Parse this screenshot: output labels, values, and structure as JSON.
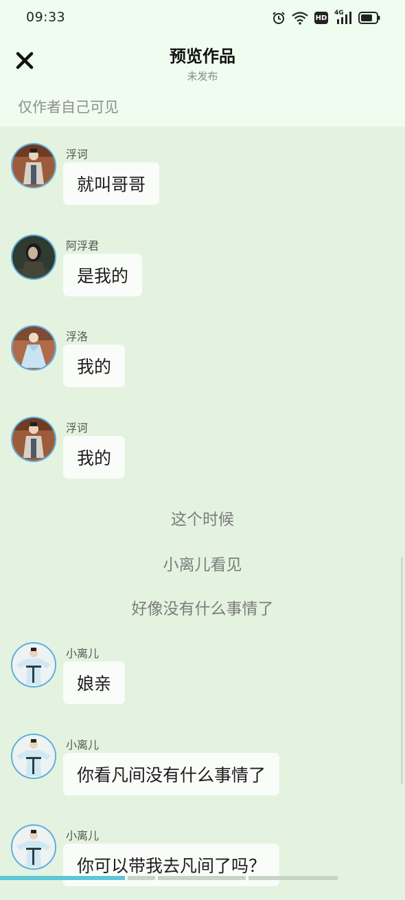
{
  "status_bar": {
    "time": "09:33",
    "icons": [
      "alarm-icon",
      "wifi-icon",
      "hd-icon",
      "signal-4g-icon",
      "battery-icon"
    ],
    "network_label": "4G",
    "hd_label": "HD"
  },
  "header": {
    "title": "预览作品",
    "subtitle": "未发布",
    "close_icon": "close-icon",
    "visibility_note": "仅作者自己可见"
  },
  "messages": [
    {
      "sender": "浮诃",
      "text": "就叫哥哥",
      "avatar": "avatar-fuhe"
    },
    {
      "sender": "阿浮君",
      "text": "是我的",
      "avatar": "avatar-afujun"
    },
    {
      "sender": "浮洛",
      "text": "我的",
      "avatar": "avatar-fuluo"
    },
    {
      "sender": "浮诃",
      "text": "我的",
      "avatar": "avatar-fuhe"
    }
  ],
  "narration": [
    "这个时候",
    "小离儿看见",
    "好像没有什么事情了"
  ],
  "messages2": [
    {
      "sender": "小离儿",
      "text": "娘亲",
      "avatar": "avatar-xiaolier"
    },
    {
      "sender": "小离儿",
      "text": "你看凡间没有什么事情了",
      "avatar": "avatar-xiaolier"
    },
    {
      "sender": "小离儿",
      "text": "你可以带我去凡间了吗？",
      "avatar": "avatar-xiaolier"
    }
  ],
  "colors": {
    "background": "#e3f3df",
    "header": "#effcef",
    "bubble": "#f9fcf8",
    "avatar_ring": "#5aaee2"
  }
}
